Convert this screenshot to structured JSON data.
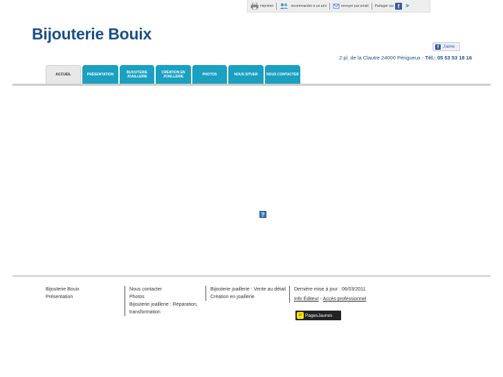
{
  "toolbar": {
    "print_label": "imprimer",
    "recommend_label": "recommander à un ami",
    "email_label": "envoyer par email",
    "share_label": "Partager sur"
  },
  "header": {
    "title": "Bijouterie Bouix",
    "like_label": "J'aime",
    "address": "2 pl. de la Clautre 24000 Périgueux",
    "address_sep": "-",
    "tel_label": "Tél.: 05 53 53 18 16"
  },
  "nav": {
    "tabs": [
      {
        "label": "ACCUEIL",
        "active": true
      },
      {
        "label": "PRÉSENTATION",
        "active": false
      },
      {
        "label": "BIJOUTERIE JOAILLERIE",
        "active": false
      },
      {
        "label": "CRÉATION EN JOAILLERIE",
        "active": false
      },
      {
        "label": "PHOTOS",
        "active": false
      },
      {
        "label": "NOUS SITUER",
        "active": false
      },
      {
        "label": "NOUS CONTACTER",
        "active": false
      }
    ]
  },
  "main": {
    "help_icon": "?"
  },
  "footer": {
    "col1": [
      "Bijouterie Bouix",
      "Présentation"
    ],
    "col2": [
      "Nous contacter",
      "Photos",
      "Bijouterie joaillerie : Réparation, transformation"
    ],
    "col3": [
      "Bijouterie joaillerie : Vente au détail",
      "Création en joaillerie"
    ],
    "col4": {
      "update": "Dernière mise à jour : 06/03/2011",
      "info_editeur": "Info Éditeur",
      "link_sep": "-",
      "acces_pro": "Accès professionnel"
    },
    "pagesjaunes_label": "PagesJaunes"
  },
  "colors": {
    "title": "#1b4f88",
    "tab": "#1aa0c0",
    "tab_active": "#e8e8e8",
    "facebook": "#3b5998"
  },
  "icons": [
    "printer-icon",
    "recommend-icon",
    "email-icon",
    "facebook-icon",
    "twitter-icon",
    "help-icon",
    "pagesjaunes-icon"
  ]
}
